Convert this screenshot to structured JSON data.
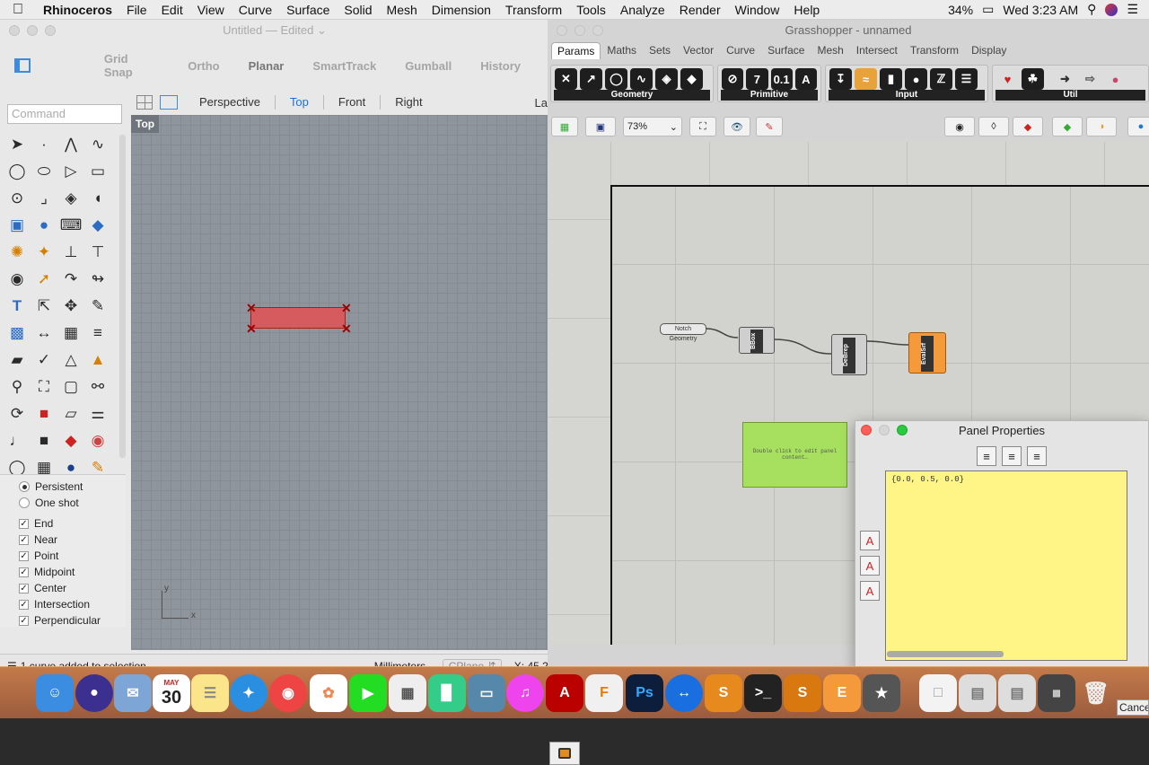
{
  "menubar": {
    "items": [
      "Rhinoceros",
      "File",
      "Edit",
      "View",
      "Curve",
      "Surface",
      "Solid",
      "Mesh",
      "Dimension",
      "Transform",
      "Tools",
      "Analyze",
      "Render",
      "Window",
      "Help"
    ],
    "battery": "34%",
    "clock": "Wed 3:23 AM"
  },
  "rhino": {
    "title": "Untitled — Edited",
    "toggles": [
      "Grid Snap",
      "Ortho",
      "Planar",
      "SmartTrack",
      "Gumball",
      "History"
    ],
    "viewport_tabs": [
      "Perspective",
      "Top",
      "Front",
      "Right"
    ],
    "active_tab": "Top",
    "extra_tab": "La",
    "command_placeholder": "Command",
    "viewport_label": "Top",
    "axis_y": "y",
    "axis_x": "x",
    "osnap_modes": {
      "persistent": "Persistent",
      "oneshot": "One shot"
    },
    "osnap_items": [
      "End",
      "Near",
      "Point",
      "Midpoint",
      "Center",
      "Intersection",
      "Perpendicular"
    ],
    "status_message": "1 curve added to selection.",
    "units": "Millimeters",
    "cplane": "CPlane",
    "coord": "X: 45.2"
  },
  "grasshopper": {
    "title": "Grasshopper - unnamed",
    "tabs": [
      "Params",
      "Maths",
      "Sets",
      "Vector",
      "Curve",
      "Surface",
      "Mesh",
      "Intersect",
      "Transform",
      "Display"
    ],
    "active_tab": "Params",
    "ribbon_groups": [
      "Geometry",
      "Primitive",
      "Input",
      "Util"
    ],
    "zoom": "73%",
    "components": {
      "notch": "Notch Geometry",
      "bbox": "BBox",
      "debrep": "DeBrep",
      "evalsrf": "EvalSrf"
    },
    "panel_hint": "Double click to edit panel content…"
  },
  "panel_properties": {
    "title": "Panel Properties",
    "content": "{0.0, 0.5, 0.0}"
  },
  "dock": {
    "calendar_month": "MAY",
    "calendar_day": "30",
    "cancel_label": "Cancel"
  },
  "colors": {
    "selection_rect": "#d9585c",
    "gh_panel": "#a6e05e",
    "evalsrf": "#f59a3b",
    "pp_text_bg": "#fef586"
  }
}
